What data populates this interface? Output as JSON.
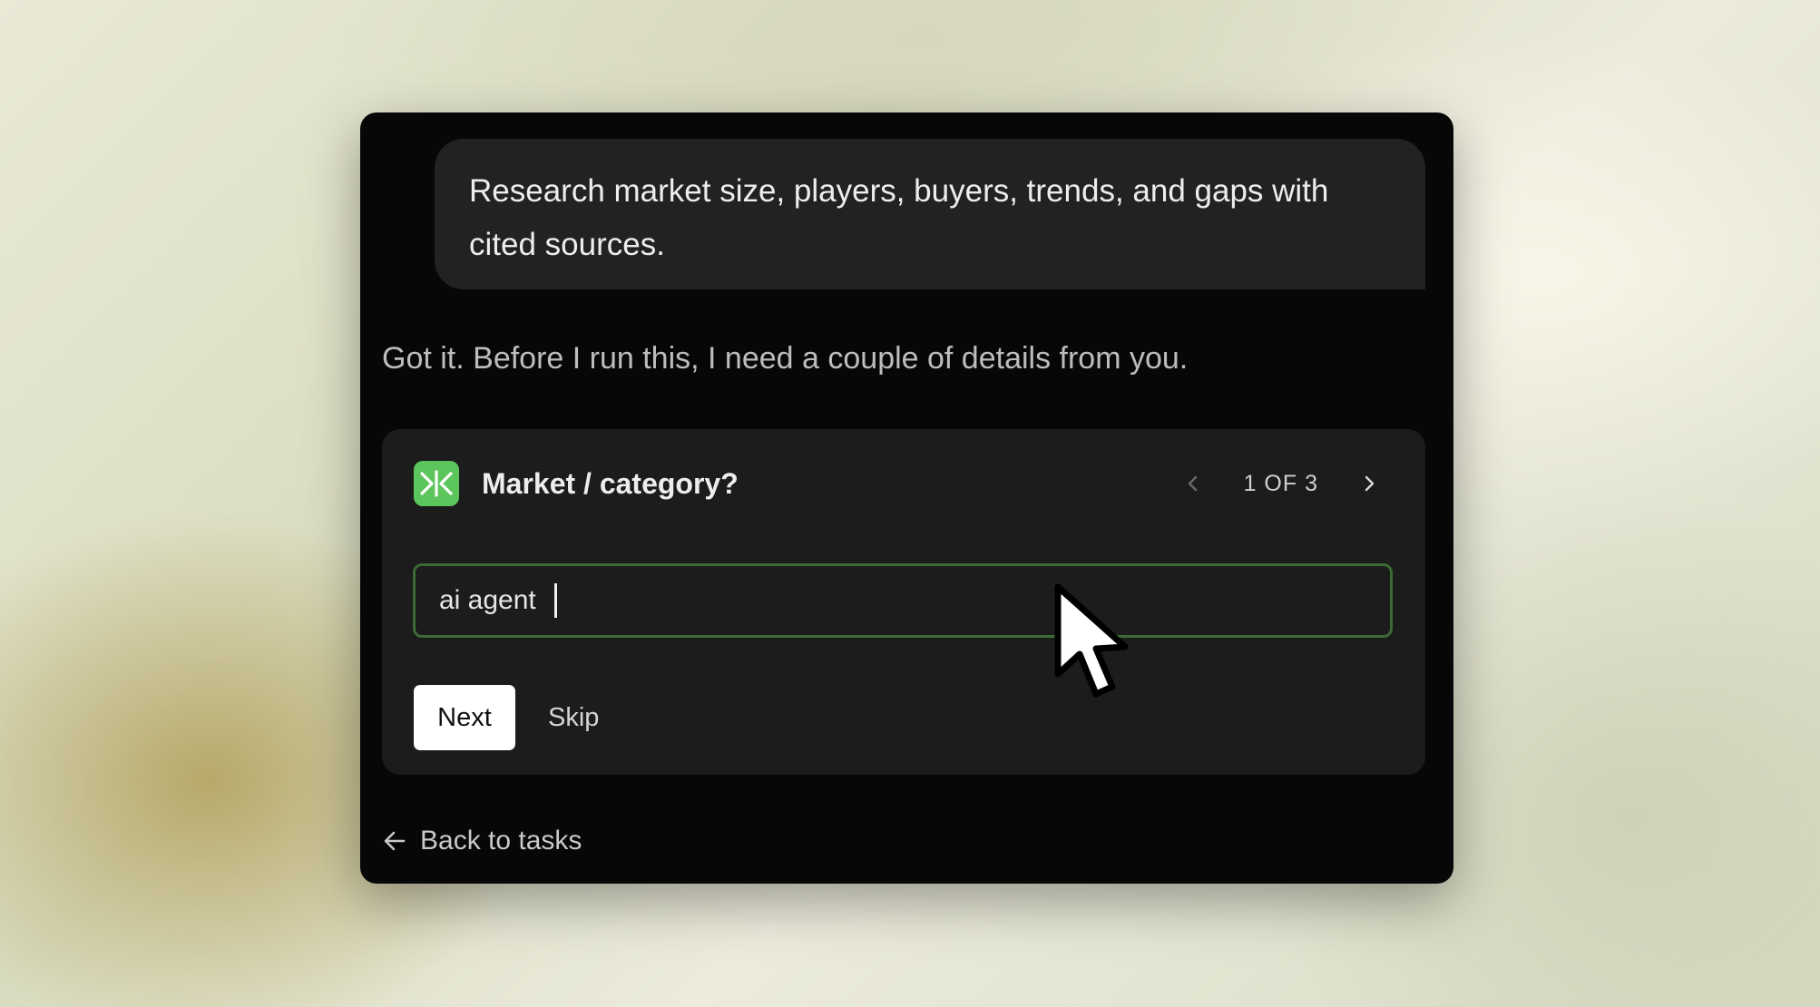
{
  "conversation": {
    "user_message": "Research market size, players, buyers, trends, and gaps with cited sources.",
    "assistant_message": "Got it. Before I run this, I need a couple of details from you."
  },
  "question_card": {
    "logo_icon": "app-logo-icon",
    "title": "Market / category?",
    "pager": {
      "label": "1 OF 3",
      "current": 1,
      "total": 3,
      "prev_icon": "chevron-left-icon",
      "next_icon": "chevron-right-icon"
    },
    "answer": {
      "value": "ai agent"
    },
    "next_label": "Next",
    "skip_label": "Skip"
  },
  "footer": {
    "back_icon": "arrow-left-icon",
    "back_label": "Back to tasks"
  },
  "colors": {
    "panel_bg": "#070707",
    "bubble_bg": "#222222",
    "card_bg": "#1c1c1c",
    "accent_green": "#5cc65c",
    "input_border": "#3b6a34"
  }
}
